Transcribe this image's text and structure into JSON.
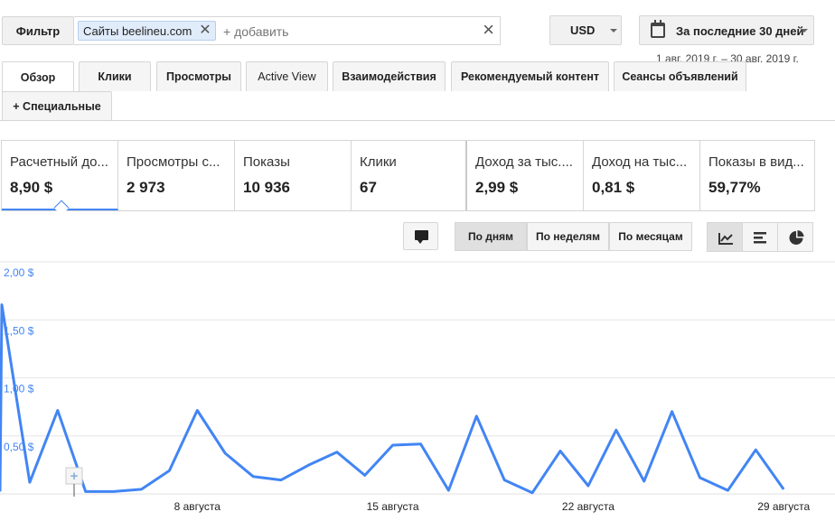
{
  "filter": {
    "button_label": "Фильтр",
    "chip_prefix": "Сайты",
    "chip_value": "beelineu.com",
    "add_placeholder": "+ добавить"
  },
  "currency": {
    "label": "USD"
  },
  "date": {
    "label": "За последние 30 дней",
    "range": "1 авг. 2019 г. – 30 авг. 2019 г."
  },
  "tabs": [
    {
      "label": "Обзор"
    },
    {
      "label": "Клики"
    },
    {
      "label": "Просмотры"
    },
    {
      "label": "Active View"
    },
    {
      "label": "Взаимодействия"
    },
    {
      "label": "Рекомендуемый контент"
    },
    {
      "label": "Сеансы объявлений"
    }
  ],
  "special_tab": {
    "label": "+ Специальные"
  },
  "metrics": [
    {
      "label": "Расчетный до...",
      "value": "8,90 $"
    },
    {
      "label": "Просмотры с...",
      "value": "2 973"
    },
    {
      "label": "Показы",
      "value": "10 936"
    },
    {
      "label": "Клики",
      "value": "67"
    },
    {
      "label": "Доход за тыс....",
      "value": "2,99 $"
    },
    {
      "label": "Доход на тыс...",
      "value": "0,81 $"
    },
    {
      "label": "Показы в вид...",
      "value": "59,77%"
    }
  ],
  "granularity": [
    {
      "label": "По дням",
      "selected": true
    },
    {
      "label": "По неделям",
      "selected": false
    },
    {
      "label": "По месяцам",
      "selected": false
    }
  ],
  "chart_types": [
    {
      "icon": "line-chart-icon",
      "selected": true
    },
    {
      "icon": "bar-chart-icon",
      "selected": false
    },
    {
      "icon": "pie-chart-icon",
      "selected": false
    }
  ],
  "colors": {
    "accent": "#4285f4"
  },
  "chart_data": {
    "type": "line",
    "ylim": [
      0,
      2.0
    ],
    "y_ticks": [
      "2,00 $",
      "1,50 $",
      "1,00 $",
      "0,50 $"
    ],
    "y_tick_values": [
      2.0,
      1.5,
      1.0,
      0.5
    ],
    "x_tick_labels": [
      {
        "day": 8,
        "label": "8 августа"
      },
      {
        "day": 15,
        "label": "15 августа"
      },
      {
        "day": 22,
        "label": "22 августа"
      },
      {
        "day": 29,
        "label": "29 августа"
      }
    ],
    "x": [
      1,
      2,
      3,
      4,
      5,
      6,
      7,
      8,
      9,
      10,
      11,
      12,
      13,
      14,
      15,
      16,
      17,
      18,
      19,
      20,
      21,
      22,
      23,
      24,
      25,
      26,
      27,
      28,
      29,
      30
    ],
    "series": [
      {
        "values": [
          1.63,
          0.1,
          0.72,
          0.02,
          0.02,
          0.04,
          0.2,
          0.72,
          0.35,
          0.15,
          0.12,
          0.25,
          0.36,
          0.16,
          0.42,
          0.43,
          0.03,
          0.67,
          0.12,
          0.01,
          0.37,
          0.07,
          0.55,
          0.11,
          0.71,
          0.14,
          0.03,
          0.38,
          0.04
        ]
      }
    ]
  }
}
